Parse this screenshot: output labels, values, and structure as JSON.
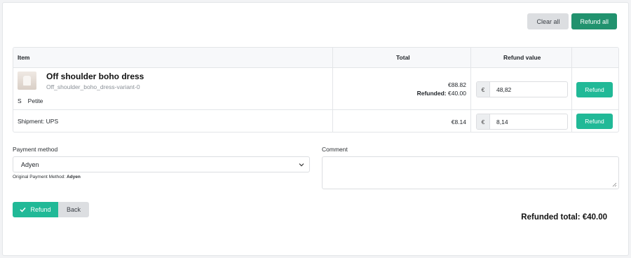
{
  "actions": {
    "clear_all": "Clear all",
    "refund_all": "Refund all"
  },
  "table": {
    "headers": {
      "item": "Item",
      "total": "Total",
      "refund_value": "Refund value"
    },
    "product": {
      "name": "Off shoulder boho dress",
      "variant": "Off_shoulder_boho_dress-variant-0",
      "size": "S",
      "fit": "Petite",
      "total": "€88.82",
      "refunded_label": "Refunded:",
      "refunded_value": "€40.00",
      "currency": "€",
      "refund_value": "48,82",
      "refund_button": "Refund"
    },
    "shipment": {
      "label": "Shipment: UPS",
      "total": "€8.14",
      "currency": "€",
      "refund_value": "8,14",
      "refund_button": "Refund"
    }
  },
  "payment": {
    "label": "Payment method",
    "selected": "Adyen",
    "original_label": "Original Payment Method:",
    "original_value": "Adyen"
  },
  "comment": {
    "label": "Comment",
    "value": ""
  },
  "footer": {
    "refund_button": "Refund",
    "back_button": "Back",
    "refunded_total": "Refunded total: €40.00"
  },
  "icons": {
    "check": "check-icon",
    "chevron": "chevron-down-icon",
    "product_image": "product-thumbnail",
    "resize": "resize-handle-icon"
  },
  "colors": {
    "accent": "#21b997",
    "accent_dark": "#21926e",
    "neutral_button": "#dcdee1"
  }
}
